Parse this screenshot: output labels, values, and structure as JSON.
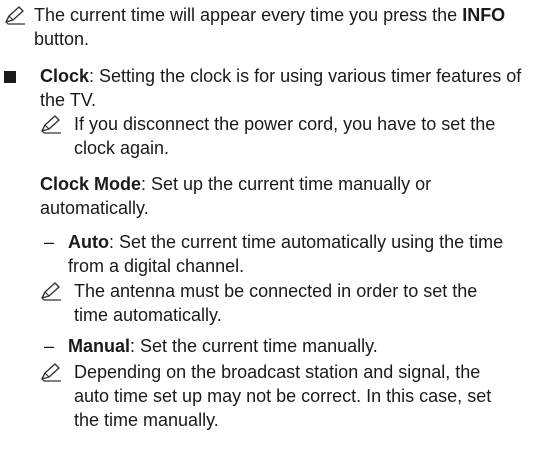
{
  "note1": {
    "before": "The current time will appear every time you press the ",
    "button": "INFO",
    "after": " button."
  },
  "clock": {
    "term": "Clock",
    "text": ": Setting the clock is for using various timer features of the TV."
  },
  "note2": {
    "text": "If you disconnect the power cord, you have to set the clock again."
  },
  "clock_mode": {
    "term": "Clock Mode",
    "text": ": Set up the current time manually or automatically."
  },
  "auto": {
    "dash": "–",
    "term": "Auto",
    "text": ": Set the current time automatically using the time from a digital channel."
  },
  "note3": {
    "text": "The antenna must be connected in order to set the time automatically."
  },
  "manual": {
    "dash": "–",
    "term": "Manual",
    "text": ": Set the current time manually."
  },
  "note4": {
    "text": "Depending on the broadcast station and signal, the auto time set up may not be correct. In this case, set the time manually."
  },
  "icons": {
    "note": "pencil-note-icon",
    "bullet": "square-bullet-icon"
  }
}
